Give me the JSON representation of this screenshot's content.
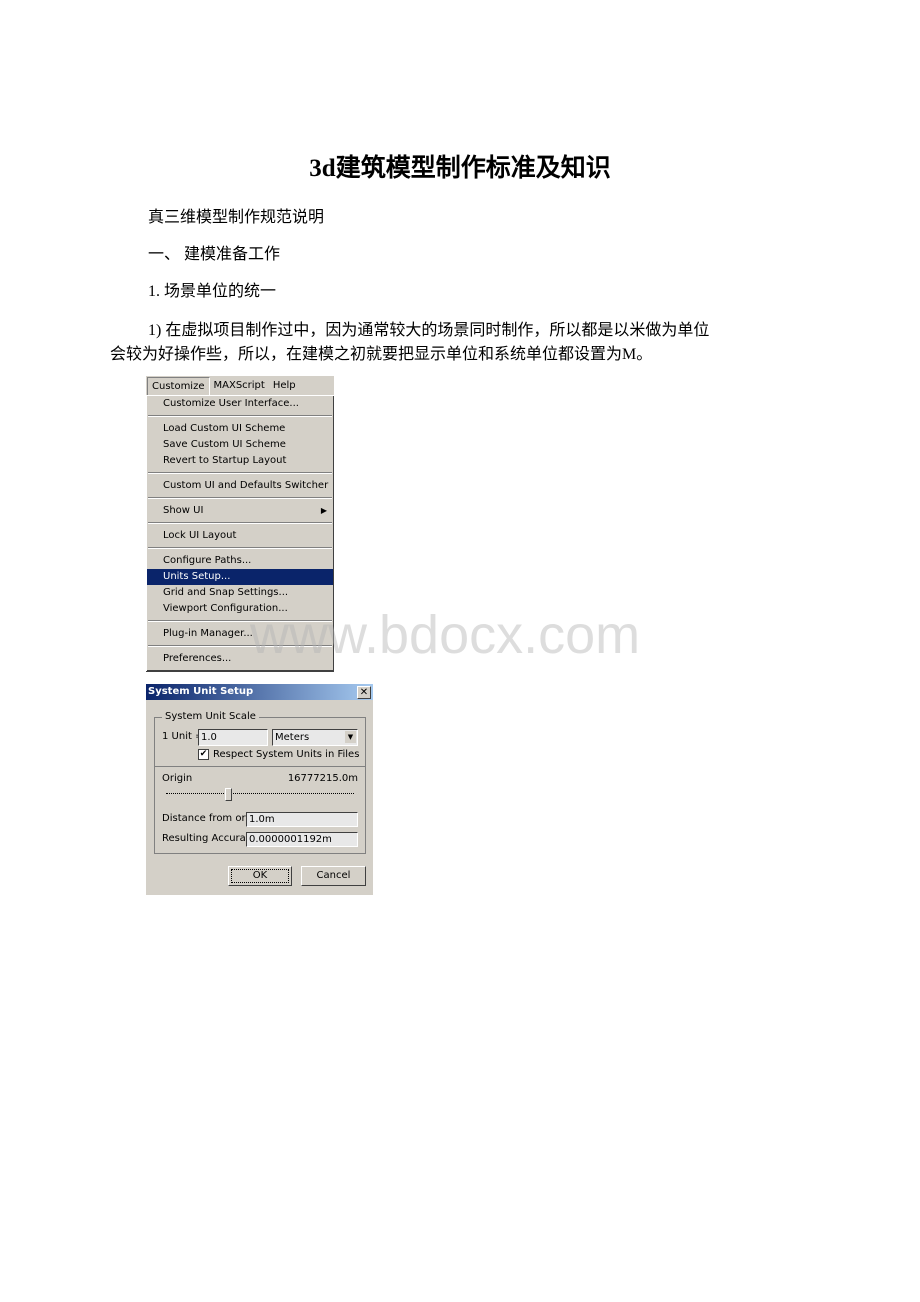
{
  "document": {
    "title": "3d建筑模型制作标准及知识",
    "paragraphs": [
      "真三维模型制作规范说明",
      "一、 建模准备工作",
      "1. 场景单位的统一",
      "1) 在虚拟项目制作过中，因为通常较大的场景同时制作，所以都是以米做为单位",
      "会较为好操作些，所以，在建模之初就要把显示单位和系统单位都设置为M。"
    ],
    "watermark": "www.bdocx.com"
  },
  "menu": {
    "bar": [
      "Customize",
      "MAXScript",
      "Help"
    ],
    "items": [
      "Customize User Interface...",
      "Load Custom UI Scheme",
      "Save Custom UI Scheme",
      "Revert to Startup Layout",
      "Custom UI and Defaults Switcher",
      "Show UI",
      "Lock UI Layout",
      "Configure Paths...",
      "Units Setup...",
      "Grid and Snap Settings...",
      "Viewport Configuration...",
      "Plug-in Manager...",
      "Preferences..."
    ],
    "selected": "Units Setup...",
    "highlight_color": "#0a246a"
  },
  "dialog": {
    "title": "System Unit Setup",
    "group": "System Unit Scale",
    "unit_label": "1 Unit =",
    "unit_value": "1.0",
    "unit_type": "Meters",
    "respect_label": "Respect System Units in Files",
    "respect_checked": true,
    "origin_label": "Origin",
    "origin_value": "16777215.0m",
    "distance_label": "Distance from origin:",
    "distance_value": "1.0m",
    "accuracy_label": "Resulting Accuracy:",
    "accuracy_value": "0.0000001192m",
    "ok": "OK",
    "cancel": "Cancel"
  }
}
